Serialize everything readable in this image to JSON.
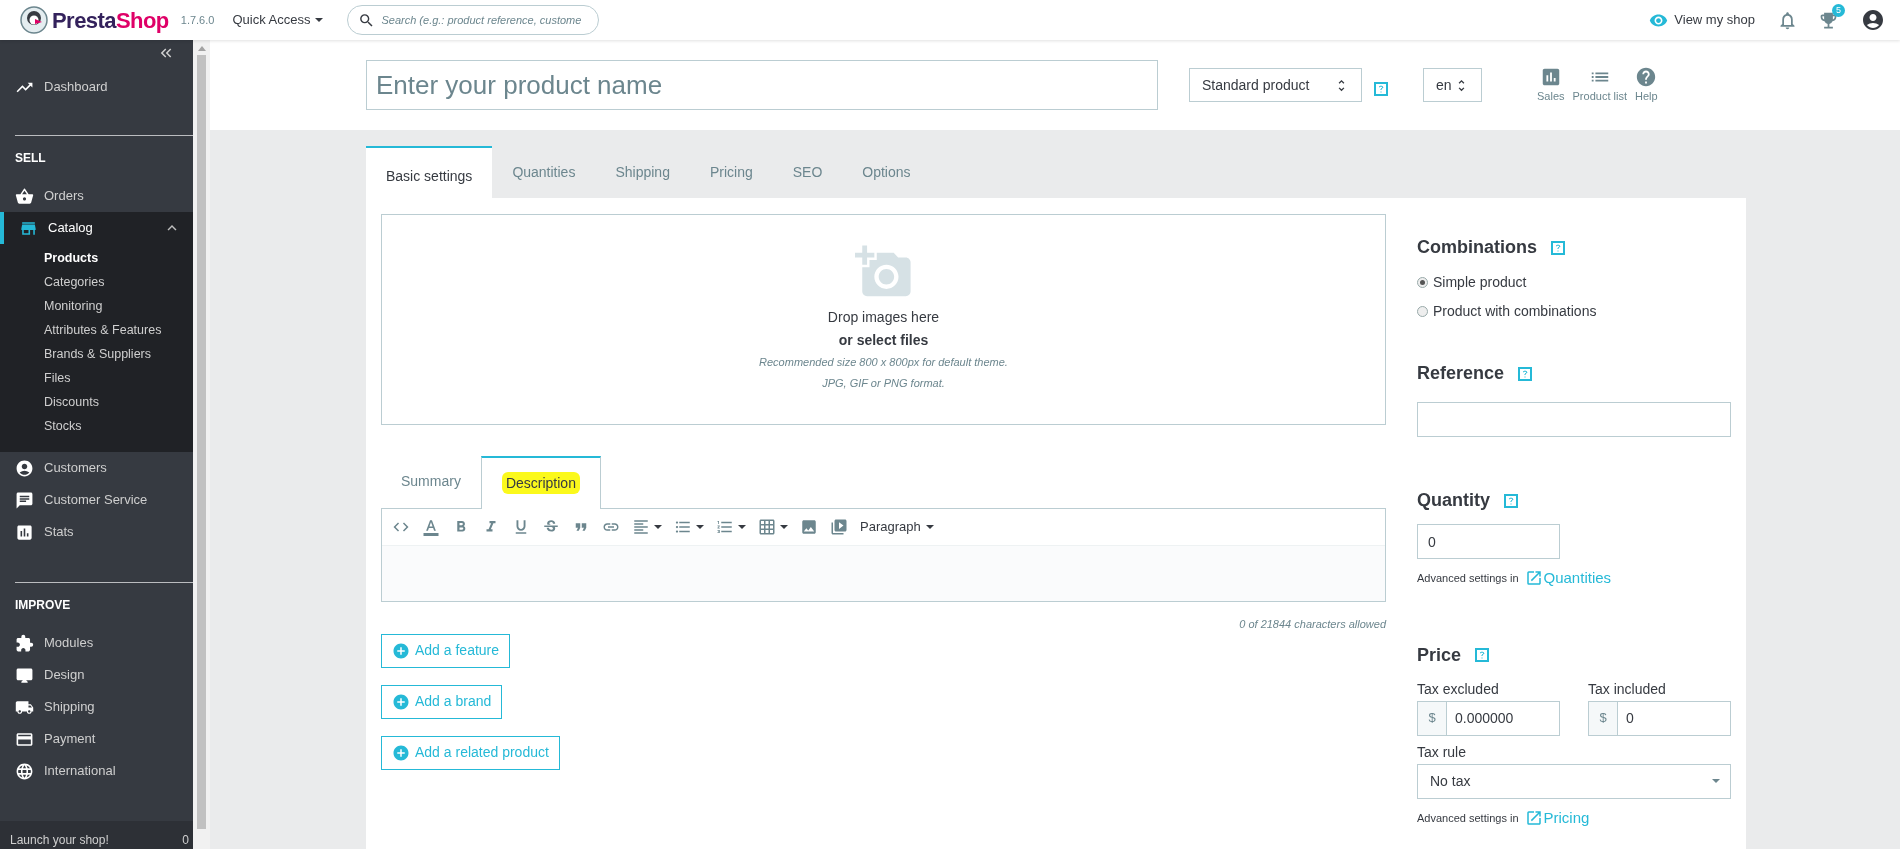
{
  "header": {
    "logo": {
      "first": "Presta",
      "second": "Shop"
    },
    "version": "1.7.6.0",
    "quick_access": "Quick Access",
    "search": {
      "placeholder": "Search (e.g.: product reference, custome"
    },
    "view_shop": "View my shop",
    "badge": "5"
  },
  "sidebar": {
    "sections": [
      {
        "items": [
          {
            "label": "Dashboard",
            "kind": "trend",
            "selected": false
          }
        ]
      },
      {
        "title": "SELL",
        "items": [
          {
            "label": "Orders",
            "kind": "basket",
            "selected": false
          },
          {
            "label": "Catalog",
            "kind": "store",
            "selected": true,
            "expanded": true,
            "children": [
              {
                "label": "Products",
                "selected": true
              },
              {
                "label": "Categories",
                "selected": false
              },
              {
                "label": "Monitoring",
                "selected": false
              },
              {
                "label": "Attributes & Features",
                "selected": false
              },
              {
                "label": "Brands & Suppliers",
                "selected": false
              },
              {
                "label": "Files",
                "selected": false
              },
              {
                "label": "Discounts",
                "selected": false
              },
              {
                "label": "Stocks",
                "selected": false
              }
            ]
          },
          {
            "label": "Customers",
            "kind": "user",
            "selected": false
          },
          {
            "label": "Customer Service",
            "kind": "chat",
            "selected": false
          },
          {
            "label": "Stats",
            "kind": "stats",
            "selected": false
          }
        ]
      },
      {
        "title": "IMPROVE",
        "items": [
          {
            "label": "Modules",
            "kind": "puzzle",
            "selected": false
          },
          {
            "label": "Design",
            "kind": "monitor",
            "selected": false
          },
          {
            "label": "Shipping",
            "kind": "truck",
            "selected": false
          },
          {
            "label": "Payment",
            "kind": "card",
            "selected": false
          },
          {
            "label": "International",
            "kind": "globe",
            "selected": false
          }
        ]
      }
    ],
    "launch": {
      "text": "Launch your shop!",
      "progress": "0"
    }
  },
  "product_header": {
    "name_placeholder": "Enter your product name",
    "type": "Standard product",
    "language": "en",
    "actions": [
      {
        "label": "Sales",
        "kind": "chart"
      },
      {
        "label": "Product list",
        "kind": "list"
      },
      {
        "label": "Help",
        "kind": "help"
      }
    ]
  },
  "tabs": [
    {
      "label": "Basic settings",
      "selected": true
    },
    {
      "label": "Quantities",
      "selected": false
    },
    {
      "label": "Shipping",
      "selected": false
    },
    {
      "label": "Pricing",
      "selected": false
    },
    {
      "label": "SEO",
      "selected": false
    },
    {
      "label": "Options",
      "selected": false
    }
  ],
  "dropzone": {
    "title": "Drop images here",
    "link": "or select files",
    "hint_1": "Recommended size 800 x 800px for default theme.",
    "hint_2": "JPG, GIF or PNG format."
  },
  "editor": {
    "tabs": [
      {
        "label": "Summary",
        "selected": false,
        "highlighted": false
      },
      {
        "label": "Description",
        "selected": true,
        "highlighted": true
      }
    ],
    "toolbar": [
      {
        "kind": "code",
        "dropdown": false
      },
      {
        "kind": "color",
        "dropdown": false
      },
      {
        "kind": "bold",
        "dropdown": false
      },
      {
        "kind": "italic",
        "dropdown": false
      },
      {
        "kind": "underline",
        "dropdown": false
      },
      {
        "kind": "strike",
        "dropdown": false
      },
      {
        "kind": "quote",
        "dropdown": false
      },
      {
        "kind": "link",
        "dropdown": false
      },
      {
        "kind": "align",
        "dropdown": true
      },
      {
        "kind": "bullets",
        "dropdown": true
      },
      {
        "kind": "numbers",
        "dropdown": true
      },
      {
        "kind": "table",
        "dropdown": true
      },
      {
        "kind": "image",
        "dropdown": false
      },
      {
        "kind": "video",
        "dropdown": false
      }
    ],
    "format": "Paragraph",
    "counter": "0 of 21844 characters allowed"
  },
  "actions": [
    "Add a feature",
    "Add a brand",
    "Add a related product"
  ],
  "combinations": {
    "title": "Combinations",
    "options": [
      {
        "label": "Simple product",
        "selected": true
      },
      {
        "label": "Product with combinations",
        "selected": false
      }
    ]
  },
  "reference": {
    "title": "Reference"
  },
  "quantity": {
    "title": "Quantity",
    "value": "0",
    "advanced_prefix": "Advanced settings in",
    "advanced_link": "Quantities"
  },
  "price": {
    "title": "Price",
    "tax_excluded": {
      "label": "Tax excluded",
      "currency": "$",
      "value": "0.000000"
    },
    "tax_included": {
      "label": "Tax included",
      "currency": "$",
      "value": "0"
    },
    "tax_rule": {
      "label": "Tax rule",
      "value": "No tax"
    },
    "advanced_prefix": "Advanced settings in",
    "advanced_link": "Pricing"
  }
}
